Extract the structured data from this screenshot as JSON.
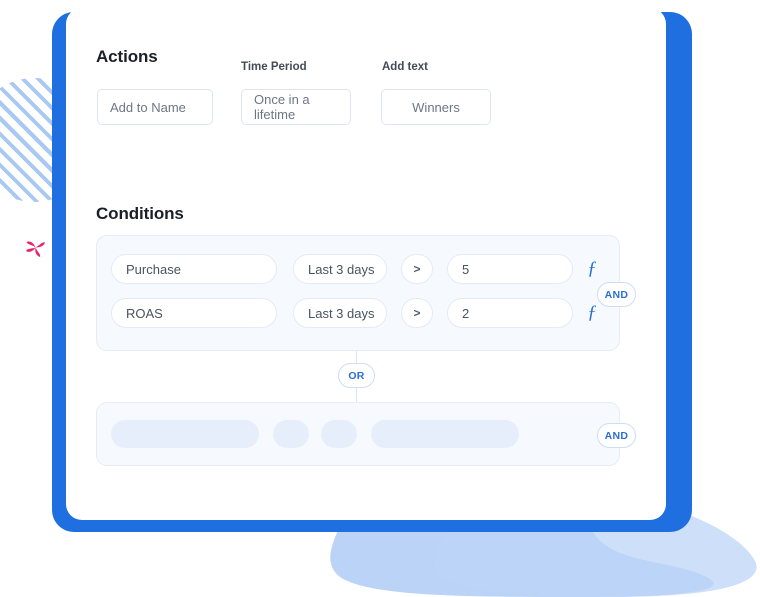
{
  "theme": {
    "accent_blue": "#1f6fe0",
    "badge_blue": "#2b6fd6",
    "card_white": "#ffffff",
    "group_background": "#f6f9fe",
    "skeleton_fill": "#e7eefb",
    "blob_blue": "#aecbf5",
    "stripe_blue": "#a9c9f2",
    "pinwheel_pink": "#e8246a"
  },
  "actions": {
    "section_title": "Actions",
    "fields": [
      {
        "label": "",
        "value": "Add to Name",
        "name": "action-name"
      },
      {
        "label": "Time Period",
        "value": "Once in a lifetime",
        "name": "action-period"
      },
      {
        "label": "Add text",
        "value": "Winners",
        "name": "action-text"
      }
    ]
  },
  "conditions": {
    "section_title": "Conditions",
    "group_1": {
      "join_badge": "AND",
      "rows": [
        {
          "metric": "Purchase",
          "period": "Last 3 days",
          "operator": ">",
          "value": "5",
          "function_icon": "function-fx-icon"
        },
        {
          "metric": "ROAS",
          "period": "Last 3 days",
          "operator": ">",
          "value": "2",
          "function_icon": "function-fx-icon"
        }
      ]
    },
    "group_join_badge": "OR",
    "group_2": {
      "join_badge": "AND",
      "placeholder_count": 4
    }
  },
  "decorations": {
    "striped_circle": "striped-circle-decoration",
    "pinwheel": "pinwheel-decoration",
    "blob": "blob-decoration"
  }
}
